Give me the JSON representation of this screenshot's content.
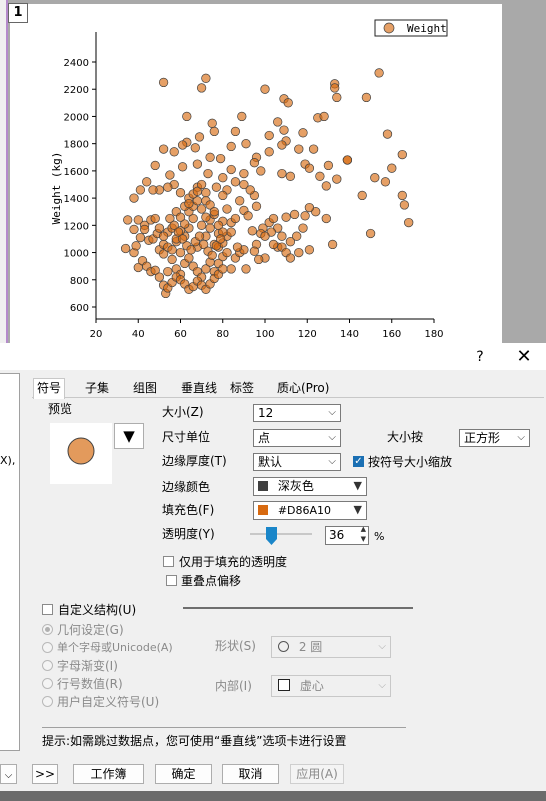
{
  "graph": {
    "layer_number": "1",
    "legend": {
      "label": "Weight"
    }
  },
  "chart_data": {
    "type": "scatter",
    "title": "",
    "xlabel": "",
    "ylabel": "Weight (kg)",
    "xlim": [
      20,
      180
    ],
    "ylim": [
      550,
      2500
    ],
    "xticks": [
      20,
      40,
      60,
      80,
      100,
      120,
      140,
      160,
      180
    ],
    "yticks": [
      600,
      800,
      1000,
      1200,
      1400,
      1600,
      1800,
      2000,
      2200,
      2400
    ],
    "legend_position": "top-right",
    "grid": false,
    "marker": {
      "shape": "circle",
      "fill": "#D86A10",
      "edge": "#404040",
      "transparency_pct": 36
    },
    "series": [
      {
        "name": "Weight",
        "points": [
          [
            52,
            2250
          ],
          [
            72,
            2280
          ],
          [
            70,
            2210
          ],
          [
            63,
            2000
          ],
          [
            75,
            1950
          ],
          [
            89,
            2000
          ],
          [
            100,
            2200
          ],
          [
            109,
            2130
          ],
          [
            111,
            2100
          ],
          [
            106,
            1960
          ],
          [
            133,
            2240
          ],
          [
            133,
            2210
          ],
          [
            134,
            2140
          ],
          [
            125,
            1990
          ],
          [
            128,
            2000
          ],
          [
            148,
            2140
          ],
          [
            154,
            2320
          ],
          [
            158,
            1870
          ],
          [
            165,
            1720
          ],
          [
            109,
            1900
          ],
          [
            110,
            1820
          ],
          [
            118,
            1880
          ],
          [
            116,
            1760
          ],
          [
            123,
            1760
          ],
          [
            119,
            1650
          ],
          [
            139,
            1680
          ],
          [
            130,
            1640
          ],
          [
            108,
            1790
          ],
          [
            102,
            1860
          ],
          [
            102,
            1740
          ],
          [
            96,
            1700
          ],
          [
            91,
            1800
          ],
          [
            86,
            1890
          ],
          [
            84,
            1780
          ],
          [
            76,
            1890
          ],
          [
            69,
            1850
          ],
          [
            67,
            1770
          ],
          [
            63,
            1810
          ],
          [
            61,
            1790
          ],
          [
            57,
            1740
          ],
          [
            52,
            1760
          ],
          [
            48,
            1640
          ],
          [
            55,
            1570
          ],
          [
            61,
            1630
          ],
          [
            68,
            1650
          ],
          [
            74,
            1700
          ],
          [
            79,
            1690
          ],
          [
            80,
            1550
          ],
          [
            73,
            1580
          ],
          [
            84,
            1610
          ],
          [
            90,
            1580
          ],
          [
            95,
            1660
          ],
          [
            98,
            1600
          ],
          [
            108,
            1580
          ],
          [
            112,
            1560
          ],
          [
            121,
            1620
          ],
          [
            126,
            1560
          ],
          [
            129,
            1490
          ],
          [
            134,
            1540
          ],
          [
            139,
            1680
          ],
          [
            146,
            1420
          ],
          [
            152,
            1550
          ],
          [
            157,
            1520
          ],
          [
            160,
            1620
          ],
          [
            165,
            1420
          ],
          [
            166,
            1350
          ],
          [
            168,
            1220
          ],
          [
            150,
            1140
          ],
          [
            132,
            1060
          ],
          [
            129,
            1250
          ],
          [
            124,
            1300
          ],
          [
            121,
            1330
          ],
          [
            119,
            1270
          ],
          [
            114,
            1280
          ],
          [
            110,
            1260
          ],
          [
            108,
            1120
          ],
          [
            106,
            1180
          ],
          [
            103,
            1150
          ],
          [
            99,
            1180
          ],
          [
            96,
            1340
          ],
          [
            95,
            1420
          ],
          [
            93,
            1460
          ],
          [
            90,
            1500
          ],
          [
            86,
            1520
          ],
          [
            82,
            1460
          ],
          [
            80,
            1420
          ],
          [
            77,
            1480
          ],
          [
            72,
            1440
          ],
          [
            68,
            1480
          ],
          [
            64,
            1400
          ],
          [
            60,
            1440
          ],
          [
            57,
            1500
          ],
          [
            54,
            1480
          ],
          [
            50,
            1460
          ],
          [
            47,
            1460
          ],
          [
            44,
            1520
          ],
          [
            41,
            1460
          ],
          [
            38,
            1400
          ],
          [
            35,
            1240
          ],
          [
            38,
            1170
          ],
          [
            40,
            1240
          ],
          [
            43,
            1200
          ],
          [
            45,
            1090
          ],
          [
            47,
            1100
          ],
          [
            49,
            1140
          ],
          [
            50,
            1020
          ],
          [
            52,
            990
          ],
          [
            54,
            1150
          ],
          [
            56,
            1180
          ],
          [
            58,
            1080
          ],
          [
            60,
            1000
          ],
          [
            62,
            1120
          ],
          [
            64,
            1180
          ],
          [
            66,
            1250
          ],
          [
            68,
            1040
          ],
          [
            70,
            1200
          ],
          [
            72,
            1120
          ],
          [
            74,
            1240
          ],
          [
            76,
            1280
          ],
          [
            78,
            1140
          ],
          [
            80,
            1230
          ],
          [
            82,
            1320
          ],
          [
            84,
            1220
          ],
          [
            86,
            1250
          ],
          [
            88,
            1380
          ],
          [
            90,
            1310
          ],
          [
            92,
            1270
          ],
          [
            94,
            1160
          ],
          [
            96,
            1060
          ],
          [
            98,
            1140
          ],
          [
            100,
            1120
          ],
          [
            102,
            1220
          ],
          [
            104,
            1250
          ],
          [
            106,
            1040
          ],
          [
            108,
            1040
          ],
          [
            110,
            1000
          ],
          [
            112,
            1080
          ],
          [
            115,
            1120
          ],
          [
            118,
            1180
          ],
          [
            121,
            1020
          ],
          [
            34,
            1030
          ],
          [
            38,
            1000
          ],
          [
            40,
            890
          ],
          [
            42,
            940
          ],
          [
            44,
            900
          ],
          [
            46,
            860
          ],
          [
            48,
            870
          ],
          [
            50,
            820
          ],
          [
            52,
            760
          ],
          [
            54,
            860
          ],
          [
            56,
            950
          ],
          [
            58,
            880
          ],
          [
            60,
            840
          ],
          [
            62,
            920
          ],
          [
            64,
            960
          ],
          [
            66,
            900
          ],
          [
            68,
            860
          ],
          [
            70,
            820
          ],
          [
            72,
            880
          ],
          [
            74,
            930
          ],
          [
            76,
            860
          ],
          [
            78,
            920
          ],
          [
            80,
            970
          ],
          [
            82,
            1000
          ],
          [
            84,
            880
          ],
          [
            86,
            960
          ],
          [
            88,
            1000
          ],
          [
            90,
            1020
          ],
          [
            100,
            960
          ],
          [
            104,
            1060
          ],
          [
            112,
            960
          ],
          [
            116,
            1000
          ],
          [
            39,
            1050
          ],
          [
            41,
            1110
          ],
          [
            43,
            1170
          ],
          [
            46,
            1240
          ],
          [
            48,
            1250
          ],
          [
            50,
            1180
          ],
          [
            52,
            1060
          ],
          [
            54,
            1040
          ],
          [
            56,
            1020
          ],
          [
            58,
            1100
          ],
          [
            60,
            1160
          ],
          [
            62,
            1210
          ],
          [
            64,
            1300
          ],
          [
            66,
            1340
          ],
          [
            68,
            1380
          ],
          [
            70,
            1320
          ],
          [
            72,
            1260
          ],
          [
            74,
            1180
          ],
          [
            76,
            1060
          ],
          [
            78,
            1040
          ],
          [
            80,
            1070
          ],
          [
            82,
            1120
          ],
          [
            84,
            1150
          ],
          [
            58,
            1300
          ],
          [
            60,
            1260
          ],
          [
            62,
            1340
          ],
          [
            64,
            1360
          ],
          [
            66,
            1430
          ],
          [
            68,
            1450
          ],
          [
            70,
            1500
          ],
          [
            72,
            1380
          ],
          [
            74,
            1350
          ],
          [
            76,
            1300
          ],
          [
            78,
            1200
          ],
          [
            80,
            1150
          ],
          [
            55,
            1250
          ],
          [
            57,
            1200
          ],
          [
            59,
            1150
          ],
          [
            61,
            1100
          ],
          [
            63,
            1050
          ],
          [
            65,
            1020
          ],
          [
            67,
            1080
          ],
          [
            69,
            1120
          ],
          [
            71,
            1060
          ],
          [
            73,
            1010
          ],
          [
            75,
            980
          ],
          [
            77,
            1050
          ],
          [
            79,
            1100
          ],
          [
            52,
            1120
          ],
          [
            53,
            700
          ],
          [
            54,
            740
          ],
          [
            56,
            780
          ],
          [
            58,
            820
          ],
          [
            60,
            800
          ],
          [
            62,
            770
          ],
          [
            64,
            730
          ],
          [
            66,
            750
          ],
          [
            68,
            790
          ],
          [
            70,
            760
          ],
          [
            72,
            730
          ],
          [
            74,
            770
          ],
          [
            76,
            810
          ],
          [
            78,
            840
          ],
          [
            80,
            880
          ],
          [
            91,
            880
          ],
          [
            87,
            1040
          ],
          [
            95,
            1010
          ],
          [
            97,
            950
          ]
        ]
      }
    ]
  },
  "dialog": {
    "help_icon": "?",
    "close_icon": "✕",
    "left_panel_text": "X),",
    "tabs": [
      "符号",
      "子集",
      "组图",
      "垂直线",
      "标签",
      "质心(Pro)"
    ],
    "preview_label": "预览",
    "preview_menu_icon": "▼",
    "size": {
      "label": "大小(Z)",
      "value": "12"
    },
    "size_unit": {
      "label": "尺寸单位",
      "value": "点"
    },
    "scale_by": {
      "label": "大小按",
      "value": "正方形"
    },
    "edge_thickness": {
      "label": "边缘厚度(T)",
      "value": "默认"
    },
    "scale_with_symbol": {
      "label": "按符号大小缩放",
      "checked": true
    },
    "edge_color": {
      "label": "边缘颜色",
      "value": "深灰色",
      "swatch": "#404040"
    },
    "fill_color": {
      "label": "填充色(F)",
      "value": "#D86A10",
      "swatch": "#D86A10"
    },
    "transparency": {
      "label": "透明度(Y)",
      "value": "36",
      "unit": "%"
    },
    "fill_only_transparency": {
      "label": "仅用于填充的透明度",
      "checked": false
    },
    "overlap_offset": {
      "label": "重叠点偏移",
      "checked": false
    },
    "custom_construction": {
      "label": "自定义结构(U)",
      "checked": false
    },
    "radio_options": [
      {
        "label": "几何设定(G)",
        "selected": true
      },
      {
        "label": "单个字母或Unicode(A)",
        "selected": false
      },
      {
        "label": "字母渐变(I)",
        "selected": false
      },
      {
        "label": "行号数值(R)",
        "selected": false
      },
      {
        "label": "用户自定义符号(U)",
        "selected": false
      }
    ],
    "shape": {
      "label": "形状(S)",
      "value": "2 圆"
    },
    "interior": {
      "label": "内部(I)",
      "value": "虚心"
    },
    "hint": "提示:如需跳过数据点，您可使用“垂直线”选项卡进行设置",
    "buttons": {
      "more": ">>",
      "workbook": "工作簿",
      "ok": "确定",
      "cancel": "取消",
      "apply": "应用(A)"
    }
  }
}
